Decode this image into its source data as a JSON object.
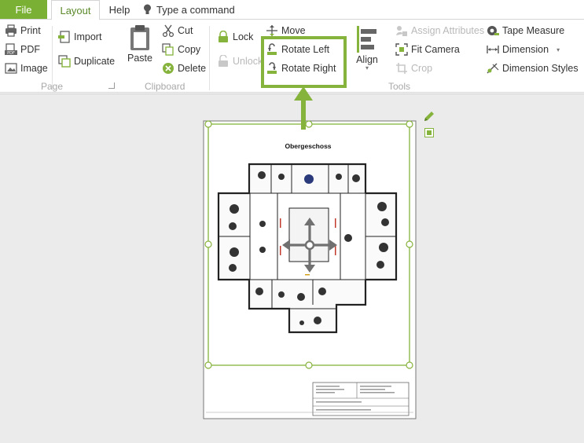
{
  "tabs": {
    "file": "File",
    "layout": "Layout",
    "help": "Help",
    "tell_me": "Type a command"
  },
  "ribbon": {
    "page": {
      "label": "Page",
      "print": "Print",
      "pdf": "PDF",
      "image": "Image"
    },
    "clipboard": {
      "label": "Clipboard",
      "import": "Import",
      "duplicate": "Duplicate",
      "paste": "Paste",
      "cut": "Cut",
      "copy": "Copy",
      "delete": "Delete"
    },
    "tools": {
      "label": "Tools",
      "lock": "Lock",
      "unlock": "Unlock",
      "move": "Move",
      "rotate_left": "Rotate Left",
      "rotate_right": "Rotate Right",
      "align": "Align",
      "assign_attributes": "Assign Attributes",
      "fit_camera": "Fit Camera",
      "crop": "Crop",
      "tape_measure": "Tape Measure",
      "dimension": "Dimension",
      "dimension_styles": "Dimension Styles"
    }
  },
  "document": {
    "plan_title": "Obergeschoss"
  },
  "colors": {
    "accent": "#86b33c",
    "file_tab": "#7ab135",
    "disabled": "#b9b9b9"
  }
}
